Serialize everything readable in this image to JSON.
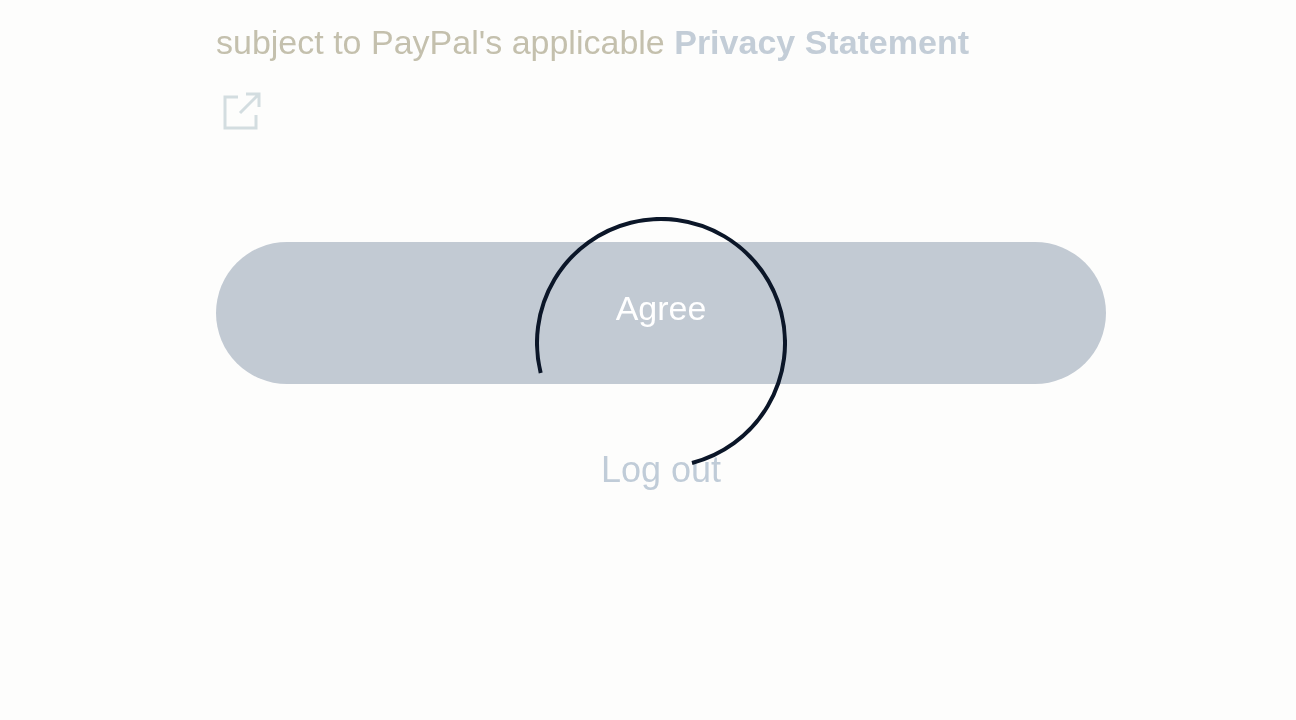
{
  "consent": {
    "text": "subject to PayPal's applicable",
    "link": "Privacy Statement",
    "external_link_icon": true
  },
  "agree_button": {
    "label": "Agree"
  },
  "logout_link": {
    "label": "Log out"
  },
  "loading": true
}
